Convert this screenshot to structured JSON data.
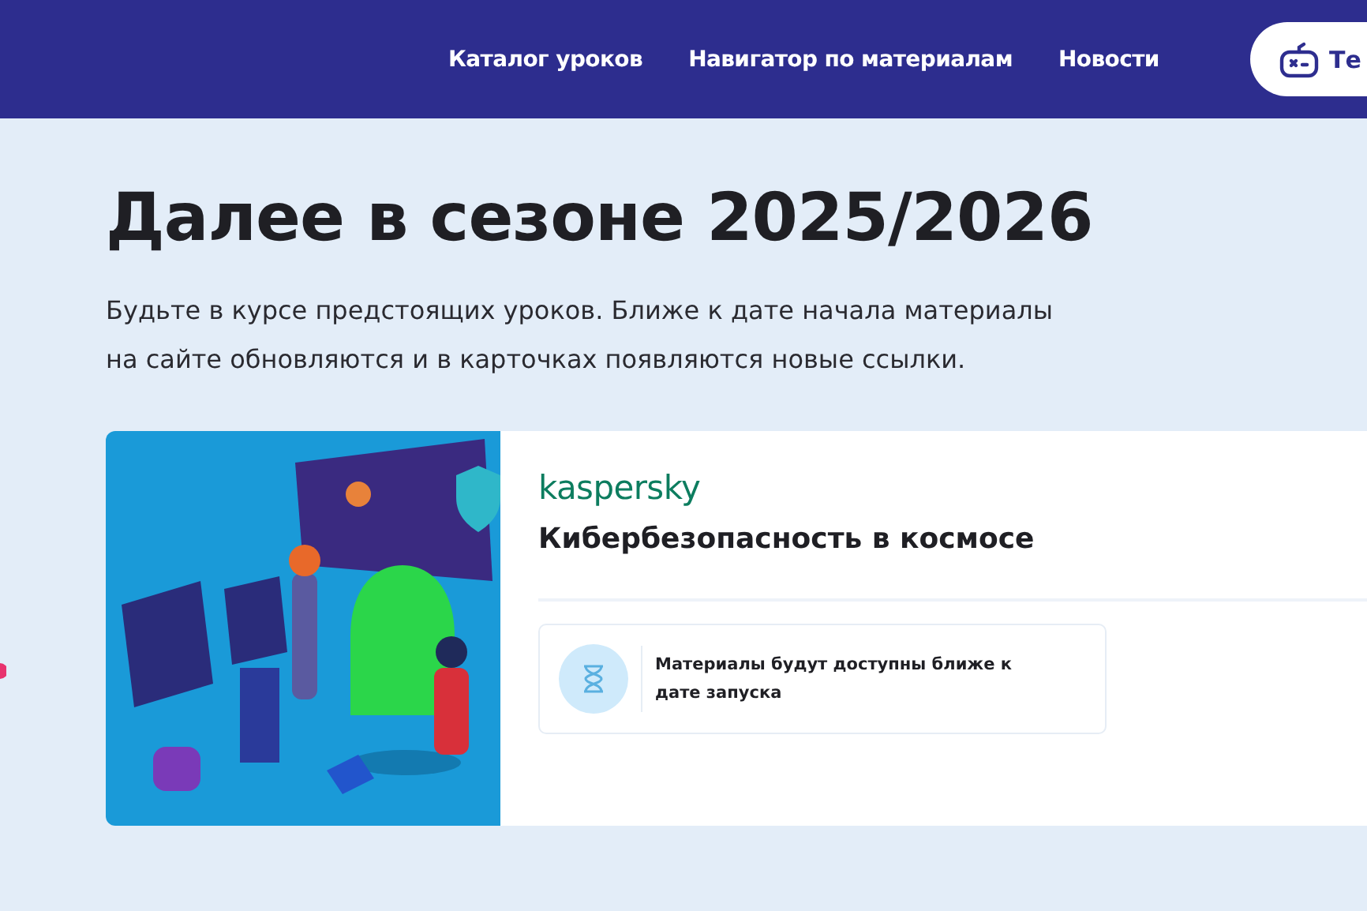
{
  "header": {
    "nav": [
      {
        "label": "Каталог уроков"
      },
      {
        "label": "Навигатор по материалам"
      },
      {
        "label": "Новости"
      }
    ],
    "action_button": {
      "label": "Те"
    }
  },
  "section": {
    "title": "Далее в сезоне 2025/2026",
    "description": "Будьте в курсе предстоящих уроков. Ближе к дате начала материалы на сайте обновляются и в карточках появляются новые ссылки."
  },
  "cards": [
    {
      "partner": "kaspersky",
      "title": "Кибербезопасность в космосе",
      "notice": "Материалы будут доступны ближе к дате запуска"
    }
  ]
}
